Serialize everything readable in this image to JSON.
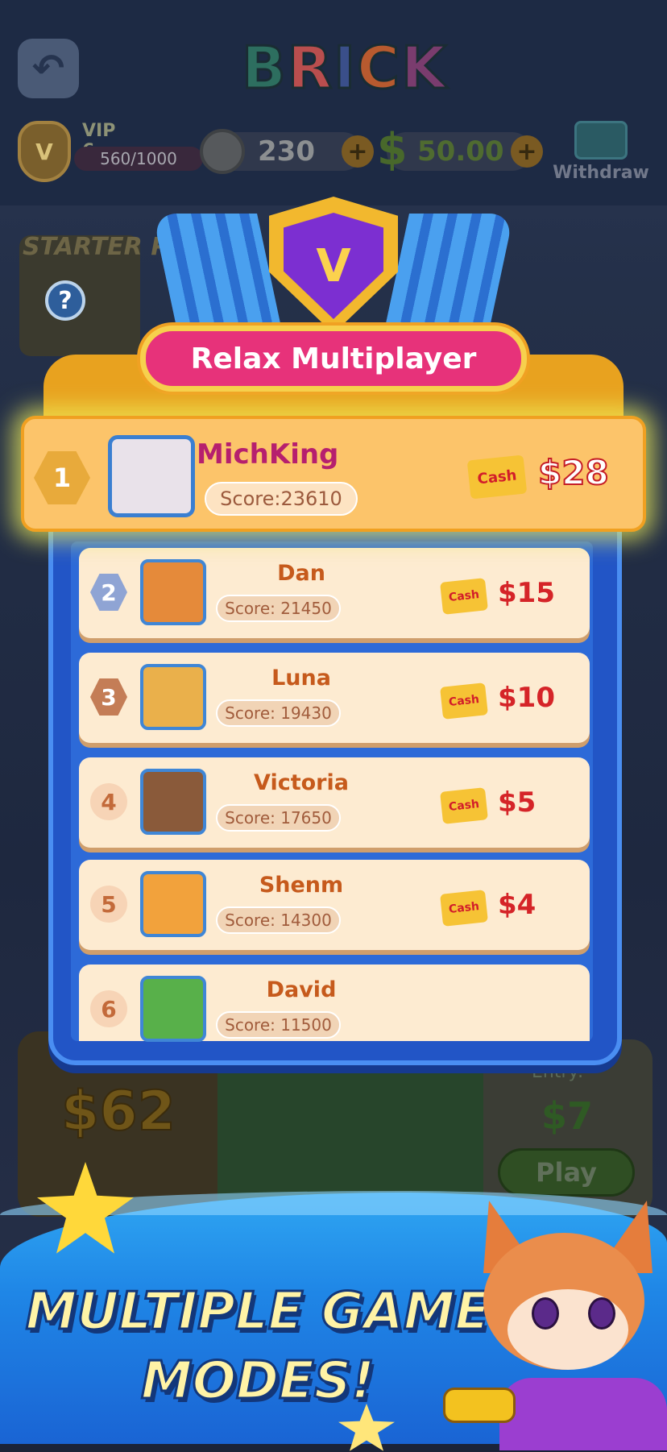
{
  "header": {
    "back_label": "back",
    "logo_letters": [
      "B",
      "R",
      "I",
      "C",
      "K"
    ],
    "vip_label": "VIP 6",
    "vip_badge_letter": "V",
    "vip_progress": "560/1000",
    "vip_progress_fraction": 0.56,
    "coins": "230",
    "cash": "50.00",
    "withdraw_label": "Withdraw"
  },
  "side": {
    "starter_pack": "STARTER PACK",
    "help": "?"
  },
  "background_game": {
    "left_amount": "$62",
    "entry_label": "Entry:",
    "entry_amount": "$7",
    "play_label": "Play"
  },
  "leaderboard": {
    "badge_letter": "V",
    "title": "Relax Multiplayer",
    "cash_label": "Cash",
    "top": {
      "rank": "1",
      "name": "MichKing",
      "score": "Score:23610",
      "prize": "$28"
    },
    "rows": [
      {
        "rank": "2",
        "name": "Dan",
        "score": "Score: 21450",
        "prize": "$15"
      },
      {
        "rank": "3",
        "name": "Luna",
        "score": "Score: 19430",
        "prize": "$10"
      },
      {
        "rank": "4",
        "name": "Victoria",
        "score": "Score: 17650",
        "prize": "$5"
      },
      {
        "rank": "5",
        "name": "Shenm",
        "score": "Score: 14300",
        "prize": "$4"
      },
      {
        "rank": "6",
        "name": "David",
        "score": "Score: 11500",
        "prize": ""
      }
    ]
  },
  "promo": {
    "line1": "MULTIPLE GAME",
    "line2": "MODES!"
  },
  "colors": {
    "panel_blue": "#2255c6",
    "top_row_gold": "#fcc46a",
    "ribbon_pink": "#e7327a",
    "prize_red": "#d52428"
  }
}
